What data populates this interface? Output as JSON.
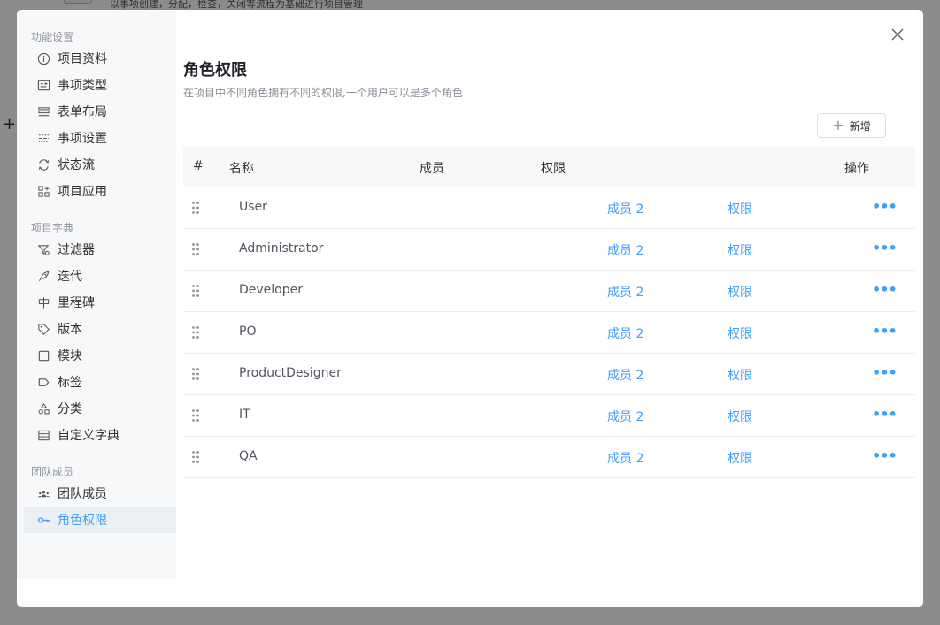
{
  "background": {
    "description_text": "以事项创建，分配，检查，关闭等流程为基础进行项目管理"
  },
  "sidebar": {
    "groups": [
      {
        "title": "功能设置",
        "items": [
          {
            "label": "项目资料",
            "icon": "info-icon"
          },
          {
            "label": "事项类型",
            "icon": "issue-type-icon"
          },
          {
            "label": "表单布局",
            "icon": "form-layout-icon"
          },
          {
            "label": "事项设置",
            "icon": "settings-sliders-icon"
          },
          {
            "label": "状态流",
            "icon": "workflow-icon"
          },
          {
            "label": "项目应用",
            "icon": "apps-icon"
          }
        ]
      },
      {
        "title": "项目字典",
        "items": [
          {
            "label": "过滤器",
            "icon": "filter-icon"
          },
          {
            "label": "迭代",
            "icon": "rocket-icon"
          },
          {
            "label": "里程碑",
            "icon": "milestone-icon"
          },
          {
            "label": "版本",
            "icon": "tag-icon"
          },
          {
            "label": "模块",
            "icon": "square-icon"
          },
          {
            "label": "标签",
            "icon": "label-icon"
          },
          {
            "label": "分类",
            "icon": "category-icon"
          },
          {
            "label": "自定义字典",
            "icon": "table-icon"
          }
        ]
      },
      {
        "title": "团队成员",
        "items": [
          {
            "label": "团队成员",
            "icon": "team-icon"
          },
          {
            "label": "角色权限",
            "icon": "key-icon",
            "active": true
          }
        ]
      }
    ]
  },
  "main": {
    "title": "角色权限",
    "description": "在项目中不同角色拥有不同的权限,一个用户可以是多个角色",
    "add_button_label": "新增",
    "columns": {
      "index": "#",
      "name": "名称",
      "members": "成员",
      "permissions": "权限",
      "actions": "操作"
    },
    "rows": [
      {
        "name": "User",
        "members": "成员 2",
        "permission": "权限"
      },
      {
        "name": "Administrator",
        "members": "成员 2",
        "permission": "权限"
      },
      {
        "name": "Developer",
        "members": "成员 2",
        "permission": "权限"
      },
      {
        "name": "PO",
        "members": "成员 2",
        "permission": "权限"
      },
      {
        "name": "ProductDesigner",
        "members": "成员 2",
        "permission": "权限"
      },
      {
        "name": "IT",
        "members": "成员 2",
        "permission": "权限"
      },
      {
        "name": "QA",
        "members": "成员 2",
        "permission": "权限"
      }
    ]
  },
  "colors": {
    "accent": "#409eff",
    "sidebar_bg": "#f7f8fa",
    "active_item_bg": "#eceff3"
  }
}
